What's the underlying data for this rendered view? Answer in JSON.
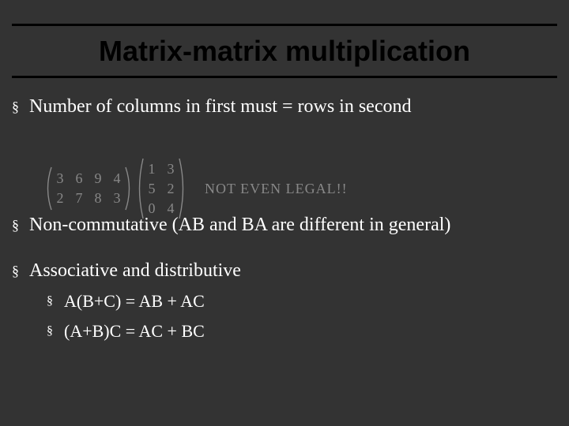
{
  "title": "Matrix-matrix multiplication",
  "bullets": {
    "b1": "Number of columns in first must  = rows in second",
    "b2": "Non-commutative (AB and BA are different in general)",
    "b3": "Associative and distributive",
    "b3a": "A(B+C) = AB + AC",
    "b3b": "(A+B)C = AC + BC"
  },
  "figure": {
    "matrixA": [
      "3",
      "6",
      "9",
      "4",
      "2",
      "7",
      "8",
      "3"
    ],
    "matrixB": [
      "1",
      "3",
      "5",
      "2",
      "0",
      "4"
    ],
    "legend": "NOT  EVEN  LEGAL!!"
  }
}
